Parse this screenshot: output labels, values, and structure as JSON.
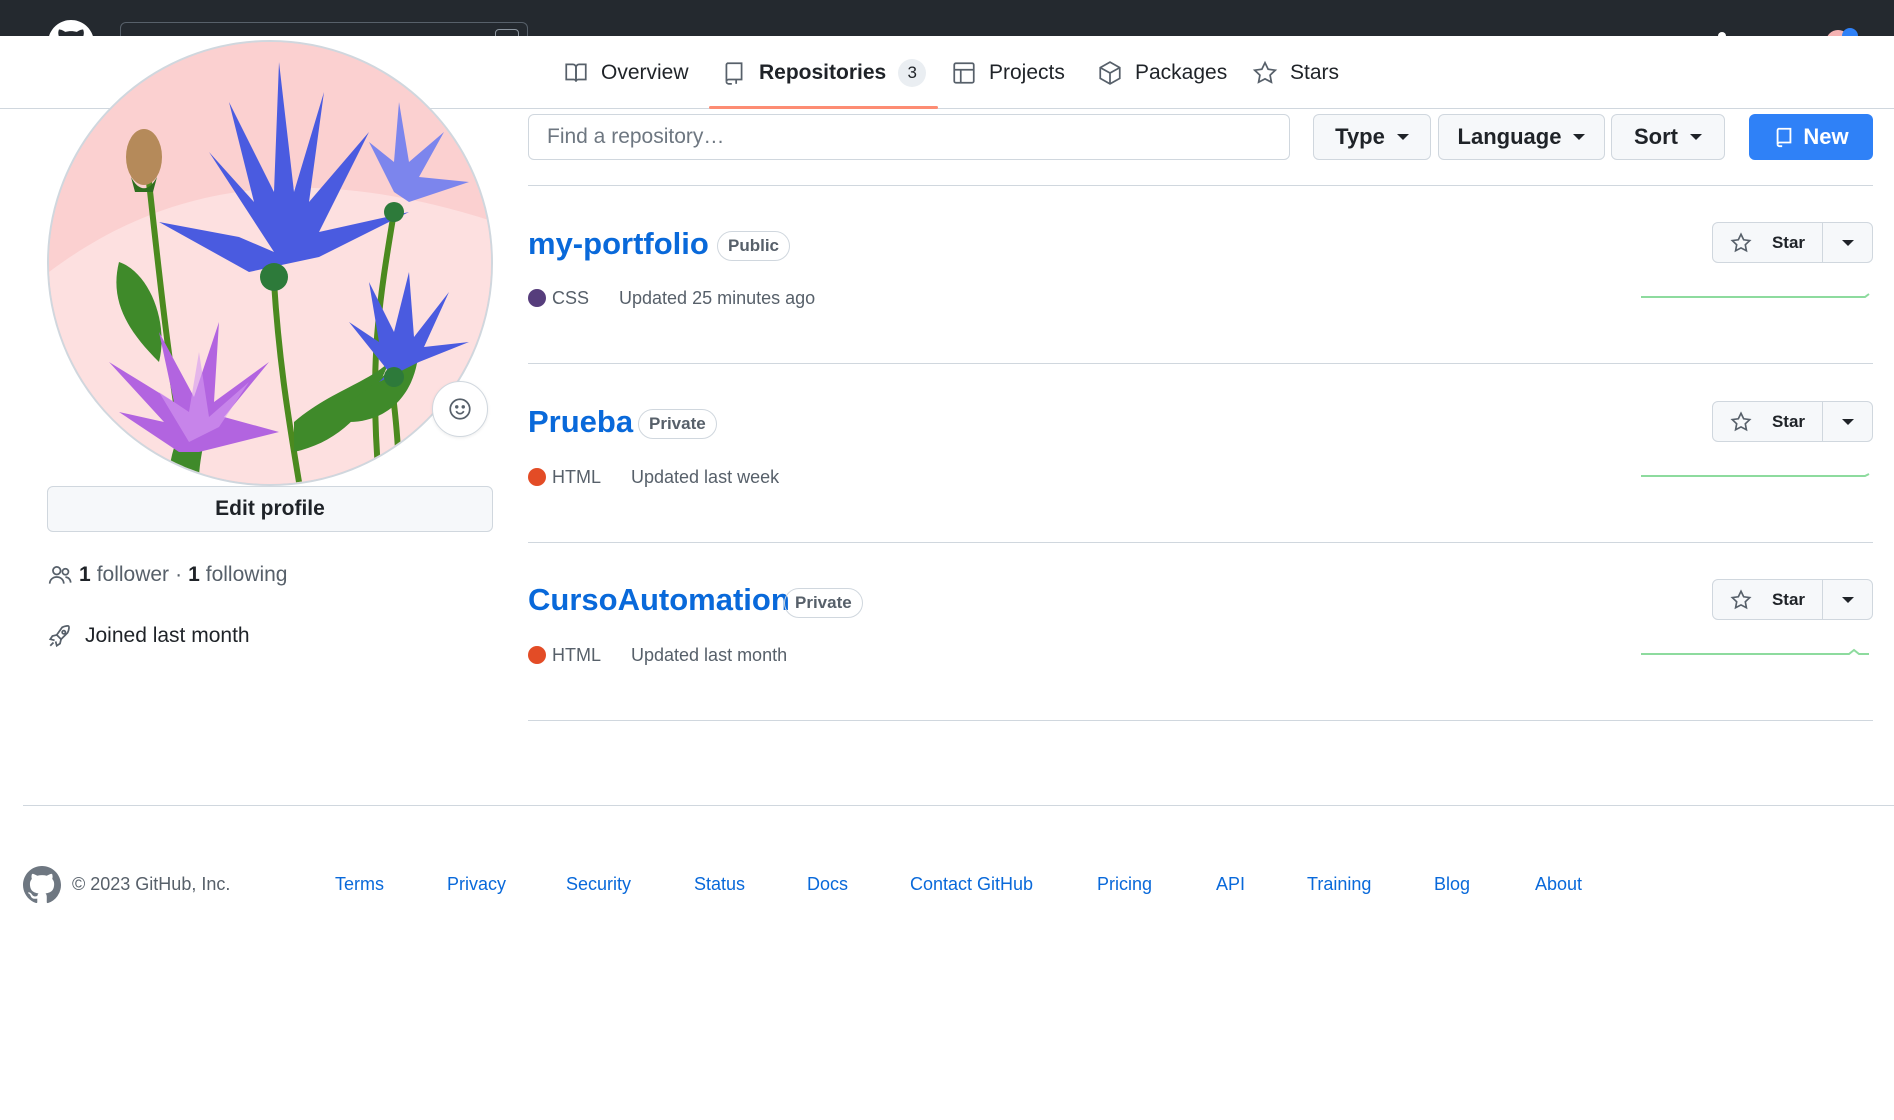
{
  "nav": {
    "tabs": [
      {
        "label": "Overview",
        "icon": "book-icon"
      },
      {
        "label": "Repositories",
        "icon": "repo-icon",
        "counter": "3",
        "selected": true
      },
      {
        "label": "Projects",
        "icon": "table-icon"
      },
      {
        "label": "Packages",
        "icon": "package-icon"
      },
      {
        "label": "Stars",
        "icon": "star-icon"
      }
    ]
  },
  "profile": {
    "edit_label": "Edit profile",
    "followers_count": "1",
    "followers_label": "follower",
    "separator": "·",
    "following_count": "1",
    "following_label": "following",
    "joined": "Joined last month"
  },
  "toolbar": {
    "search_placeholder": "Find a repository…",
    "type_label": "Type",
    "language_label": "Language",
    "sort_label": "Sort",
    "new_label": "New"
  },
  "repos": [
    {
      "name": "my-portfolio",
      "visibility": "Public",
      "language": "CSS",
      "language_color": "#563d7c",
      "updated": "Updated 25 minutes ago",
      "star_label": "Star"
    },
    {
      "name": "Prueba",
      "visibility": "Private",
      "language": "HTML",
      "language_color": "#e34c26",
      "updated": "Updated last week",
      "star_label": "Star"
    },
    {
      "name": "CursoAutomation",
      "visibility": "Private",
      "language": "HTML",
      "language_color": "#e34c26",
      "updated": "Updated last month",
      "star_label": "Star"
    }
  ],
  "footer": {
    "copyright": "© 2023 GitHub, Inc.",
    "links": [
      "Terms",
      "Privacy",
      "Security",
      "Status",
      "Docs",
      "Contact GitHub",
      "Pricing",
      "API",
      "Training",
      "Blog",
      "About"
    ]
  },
  "colors": {
    "accent": "#2f81f7",
    "link": "#0969da",
    "selected_tab_underline": "#fd8c73",
    "sparkline": "#8ddb9e"
  }
}
